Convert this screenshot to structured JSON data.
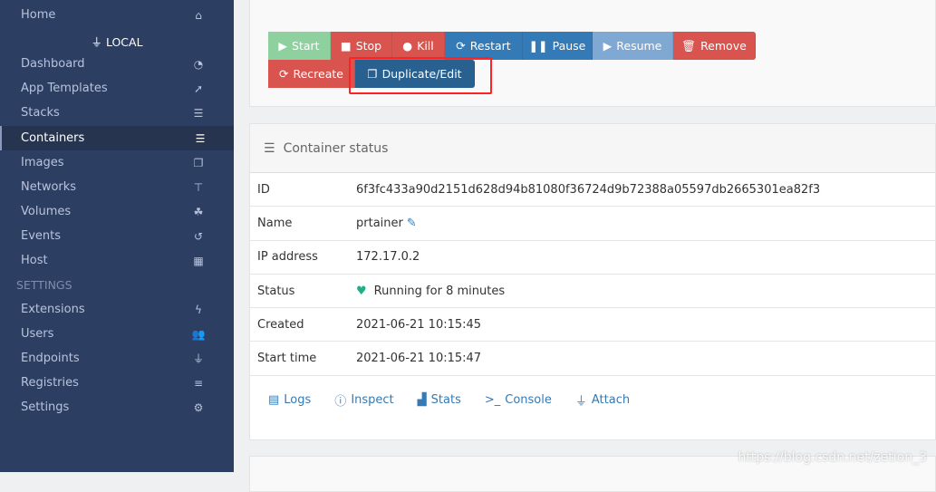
{
  "sidebar": {
    "home": "Home",
    "endpoint": "LOCAL",
    "items": [
      "Dashboard",
      "App Templates",
      "Stacks",
      "Containers",
      "Images",
      "Networks",
      "Volumes",
      "Events",
      "Host"
    ],
    "settings_header": "SETTINGS",
    "settings_items": [
      "Extensions",
      "Users",
      "Endpoints",
      "Registries",
      "Settings"
    ]
  },
  "actions": {
    "start": "Start",
    "stop": "Stop",
    "kill": "Kill",
    "restart": "Restart",
    "pause": "Pause",
    "resume": "Resume",
    "remove": "Remove",
    "recreate": "Recreate",
    "duplicate": "Duplicate/Edit"
  },
  "status": {
    "title": "Container status",
    "rows": [
      {
        "k": "ID",
        "v": "6f3fc433a90d2151d628d94b81080f36724d9b72388a05597db2665301ea82f3"
      },
      {
        "k": "Name",
        "v": "prtainer"
      },
      {
        "k": "IP address",
        "v": "172.17.0.2"
      },
      {
        "k": "Status",
        "v": "Running for 8 minutes"
      },
      {
        "k": "Created",
        "v": "2021-06-21 10:15:45"
      },
      {
        "k": "Start time",
        "v": "2021-06-21 10:15:47"
      }
    ],
    "links": [
      "Logs",
      "Inspect",
      "Stats",
      "Console",
      "Attach"
    ]
  },
  "watermark": "https://blog.csdn.net/zetion_3"
}
